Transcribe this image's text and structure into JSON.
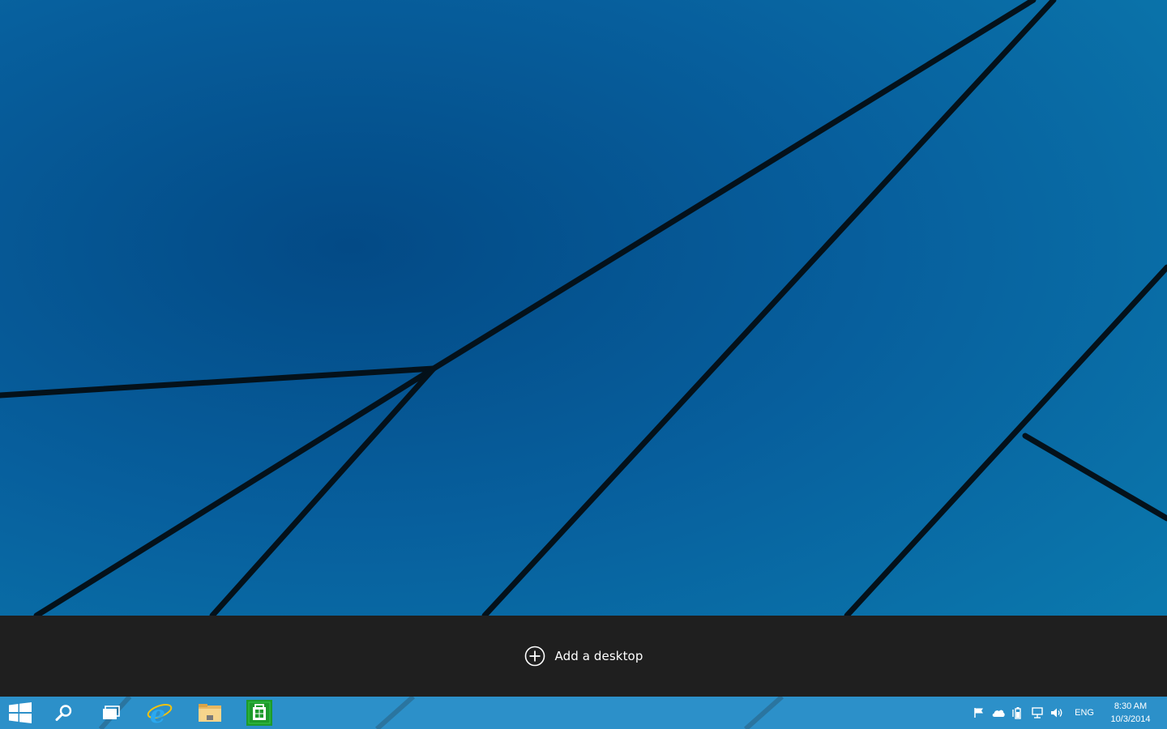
{
  "virtual_desktops": {
    "add_desktop_label": "Add a desktop"
  },
  "taskbar": {
    "pinned": [
      {
        "name": "start-button",
        "icon": "windows-logo-icon"
      },
      {
        "name": "search-button",
        "icon": "search-icon"
      },
      {
        "name": "task-view-button",
        "icon": "task-view-icon"
      },
      {
        "name": "internet-explorer-button",
        "icon": "internet-explorer-icon"
      },
      {
        "name": "file-explorer-button",
        "icon": "folder-icon"
      },
      {
        "name": "store-button",
        "icon": "store-icon"
      }
    ],
    "tray": {
      "icons": [
        "action-center-flag-icon",
        "onedrive-cloud-icon",
        "power-icon",
        "network-icon",
        "volume-icon"
      ],
      "language": "ENG",
      "time": "8:30 AM",
      "date": "10/3/2014"
    }
  },
  "colors": {
    "wallpaper_blue": "#0a5e98",
    "virtual_desktop_bar": "#1f1f1f",
    "taskbar": "#2b8ec7",
    "store_green": "#1d9a2b"
  }
}
